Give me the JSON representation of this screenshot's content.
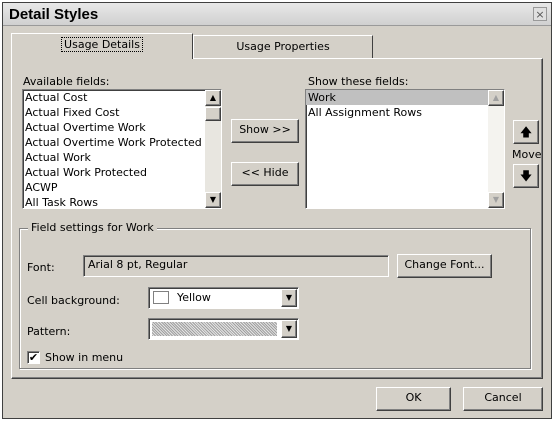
{
  "window": {
    "title": "Detail Styles",
    "close_label": "×"
  },
  "tabs": [
    {
      "label": "Usage Details",
      "active": true
    },
    {
      "label": "Usage Properties",
      "active": false
    }
  ],
  "available_fields": {
    "label": "Available fields:",
    "items": [
      "Actual Cost",
      "Actual Fixed Cost",
      "Actual Overtime Work",
      "Actual Overtime Work Protected",
      "Actual Work",
      "Actual Work Protected",
      "ACWP",
      "All Task Rows"
    ]
  },
  "show_fields": {
    "label": "Show these fields:",
    "items": [
      "Work",
      "All Assignment Rows"
    ],
    "selected_index": 0
  },
  "buttons": {
    "show": "Show >>",
    "hide": "<< Hide",
    "move_label": "Move",
    "move_up": "🡅",
    "move_down": "🡇",
    "change_font": "Change Font...",
    "ok": "OK",
    "cancel": "Cancel"
  },
  "field_settings": {
    "legend": "Field settings for Work",
    "font_label": "Font:",
    "font_value": "Arial 8 pt, Regular",
    "cell_background_label": "Cell background:",
    "cell_background_value": "Yellow",
    "cell_background_swatch": "#ffffff",
    "pattern_label": "Pattern:",
    "show_in_menu_label": "Show in menu",
    "show_in_menu_checked": true
  },
  "colors": {
    "dialog_face": "#d4d0c8",
    "selection": "#c0c0c0"
  }
}
